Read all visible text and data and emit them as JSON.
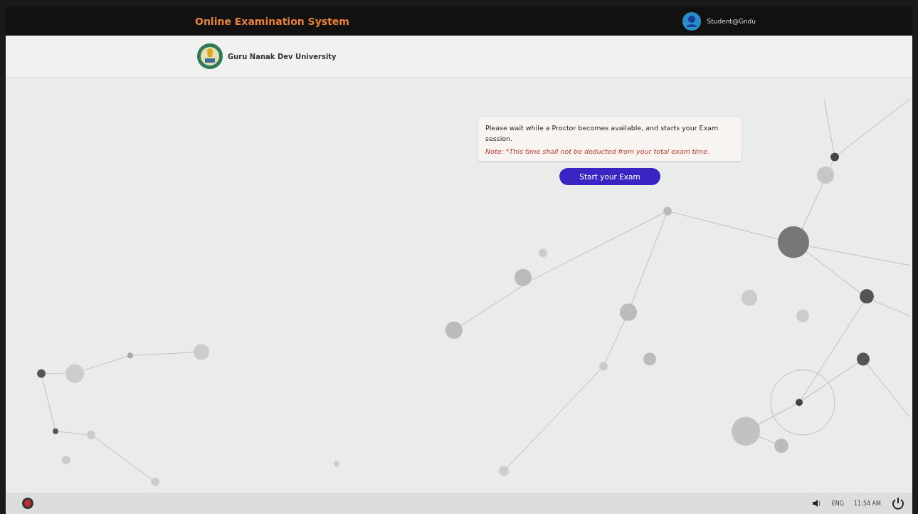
{
  "topbar": {
    "title": "Online Examination System",
    "user": "Student@Gndu"
  },
  "header": {
    "university": "Guru Nanak Dev University"
  },
  "notice": {
    "message": "Please wait while a Proctor becomes available, and starts your Exam session.",
    "note": "Note: *This time shall not be deducted from your total exam time."
  },
  "start_button": {
    "label": "Start your Exam"
  },
  "taskbar": {
    "language": "ENG",
    "time": "11:54 AM"
  }
}
